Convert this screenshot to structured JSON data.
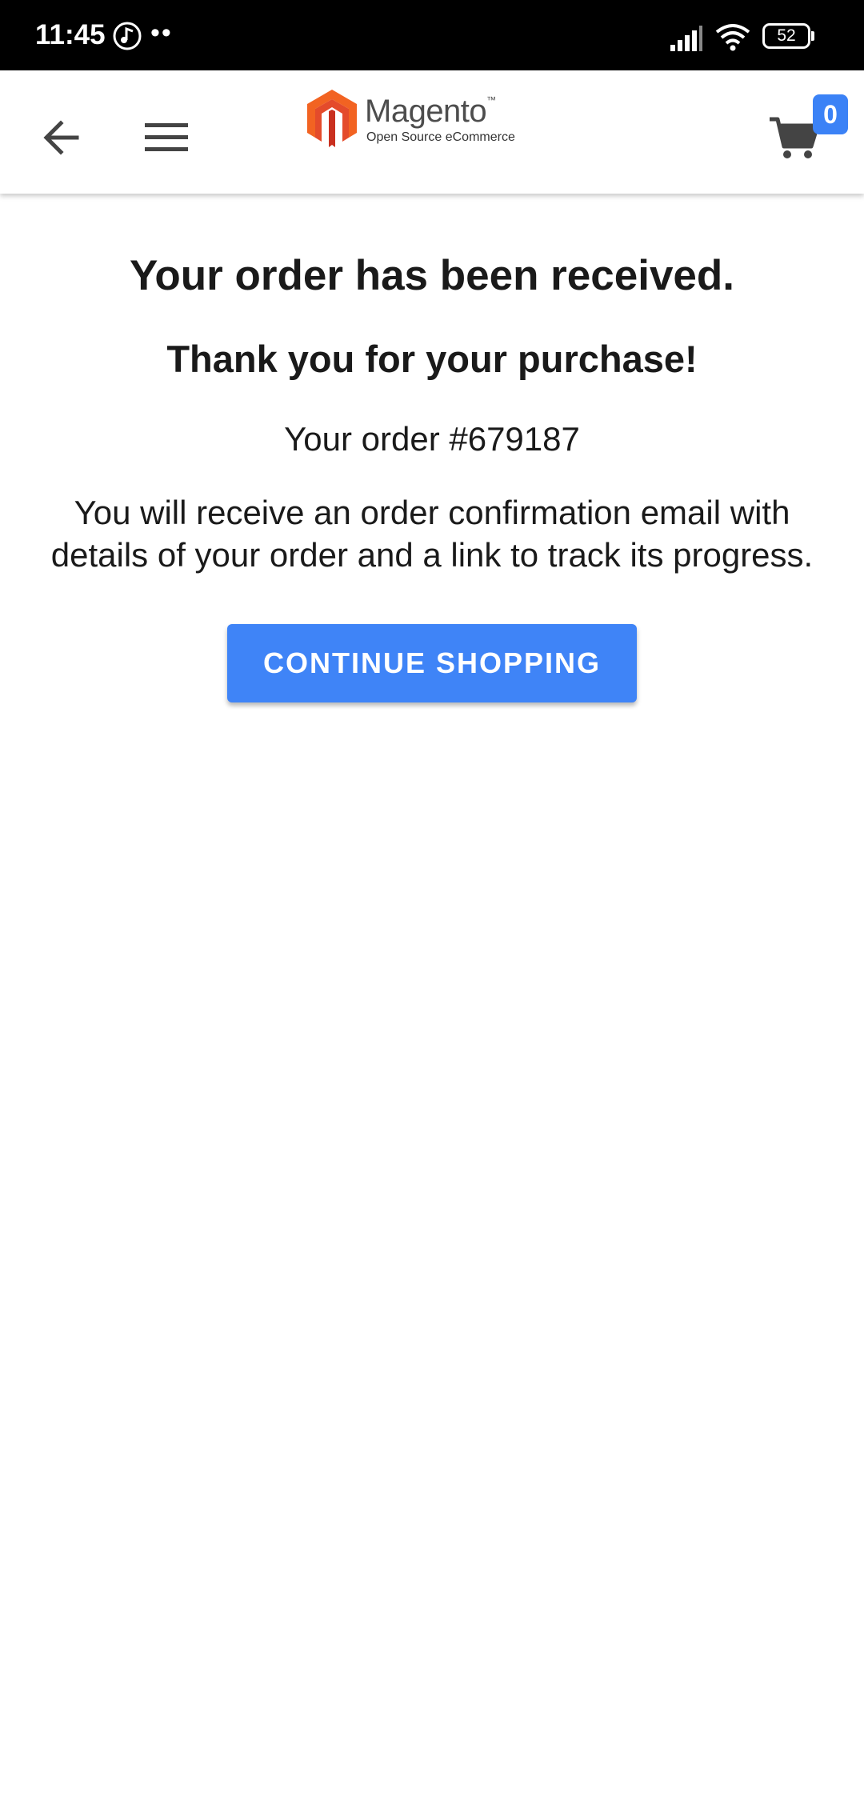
{
  "status_bar": {
    "time": "11:45",
    "dots": "••",
    "battery": "52"
  },
  "header": {
    "logo_word": "Magento",
    "logo_tm": "™",
    "logo_sub": "Open Source eCommerce",
    "cart_count": "0"
  },
  "main": {
    "title": "Your order has been received.",
    "subtitle": "Thank you for your purchase!",
    "order_number": "Your order #679187",
    "message": "You will receive an order confirmation email with details of your order and a link to track its progress.",
    "continue_button": "CONTINUE SHOPPING"
  },
  "colors": {
    "accent": "#3f84f7",
    "logo_orange": "#f26322",
    "logo_red": "#e44b2b",
    "icon_gray": "#444444"
  },
  "icons": [
    "music-note-icon",
    "signal-icon",
    "wifi-icon",
    "battery-icon",
    "back-arrow-icon",
    "menu-icon",
    "magento-logo-icon",
    "cart-icon"
  ]
}
